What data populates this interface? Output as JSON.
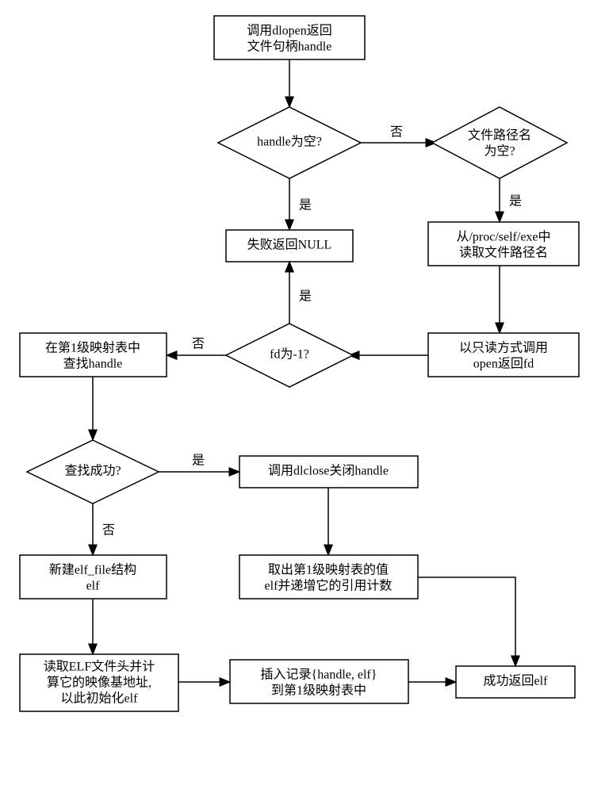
{
  "nodes": {
    "n1a": "调用dlopen返回",
    "n1b": "文件句柄handle",
    "d1": "handle为空?",
    "d2a": "文件路径名",
    "d2b": "为空?",
    "n2": "失败返回NULL",
    "n3a": "从/proc/self/exe中",
    "n3b": "读取文件路径名",
    "n4a": "以只读方式调用",
    "n4b": "open返回fd",
    "d3": "fd为-1?",
    "n5a": "在第1级映射表中",
    "n5b": "查找handle",
    "d4": "查找成功?",
    "n6": "调用dlclose关闭handle",
    "n7a": "取出第1级映射表的值",
    "n7b": "elf并递增它的引用计数",
    "n8a": "新建elf_file结构",
    "n8b": "elf",
    "n9a": "读取ELF文件头并计",
    "n9b": "算它的映像基地址,",
    "n9c": "以此初始化elf",
    "n10a": "插入记录{handle, elf}",
    "n10b": "到第1级映射表中",
    "n11": "成功返回elf"
  },
  "edges": {
    "yes": "是",
    "no": "否"
  }
}
